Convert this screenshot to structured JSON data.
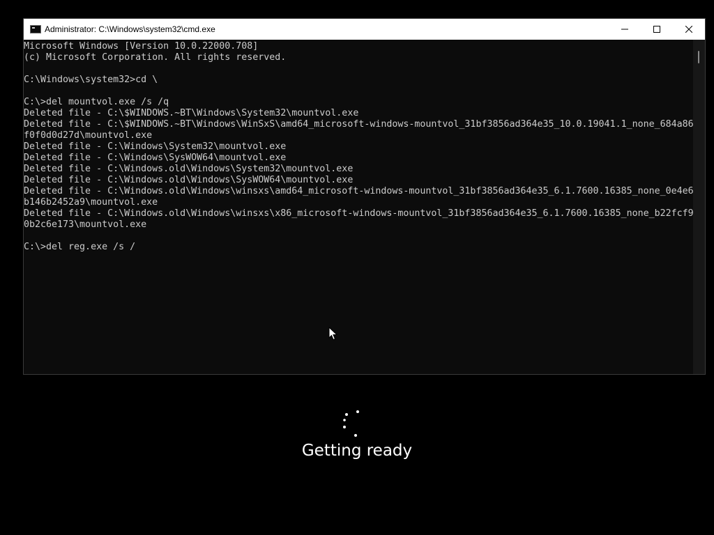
{
  "window": {
    "title": "Administrator: C:\\Windows\\system32\\cmd.exe",
    "icon": "console-icon",
    "controls": [
      "minimize-icon",
      "maximize-icon",
      "close-icon"
    ]
  },
  "console": {
    "lines": [
      "Microsoft Windows [Version 10.0.22000.708]",
      "(c) Microsoft Corporation. All rights reserved.",
      "",
      "C:\\Windows\\system32>cd \\",
      "",
      "C:\\>del mountvol.exe /s /q",
      "Deleted file - C:\\$WINDOWS.~BT\\Windows\\System32\\mountvol.exe",
      "Deleted file - C:\\$WINDOWS.~BT\\Windows\\WinSxS\\amd64_microsoft-windows-mountvol_31bf3856ad364e35_10.0.19041.1_none_684a86",
      "f0f0d0d27d\\mountvol.exe",
      "Deleted file - C:\\Windows\\System32\\mountvol.exe",
      "Deleted file - C:\\Windows\\SysWOW64\\mountvol.exe",
      "Deleted file - C:\\Windows.old\\Windows\\System32\\mountvol.exe",
      "Deleted file - C:\\Windows.old\\Windows\\SysWOW64\\mountvol.exe",
      "Deleted file - C:\\Windows.old\\Windows\\winsxs\\amd64_microsoft-windows-mountvol_31bf3856ad364e35_6.1.7600.16385_none_0e4e6",
      "b146b2452a9\\mountvol.exe",
      "Deleted file - C:\\Windows.old\\Windows\\winsxs\\x86_microsoft-windows-mountvol_31bf3856ad364e35_6.1.7600.16385_none_b22fcf9",
      "0b2c6e173\\mountvol.exe",
      "",
      "C:\\>del reg.exe /s /"
    ]
  },
  "overlay": {
    "status_text": "Getting ready",
    "spinner_icon": "loading-spinner-icon"
  },
  "colors": {
    "console_bg": "#0c0c0c",
    "console_text": "#cccccc",
    "titlebar_bg": "#ffffff",
    "desktop_bg": "#000000"
  }
}
